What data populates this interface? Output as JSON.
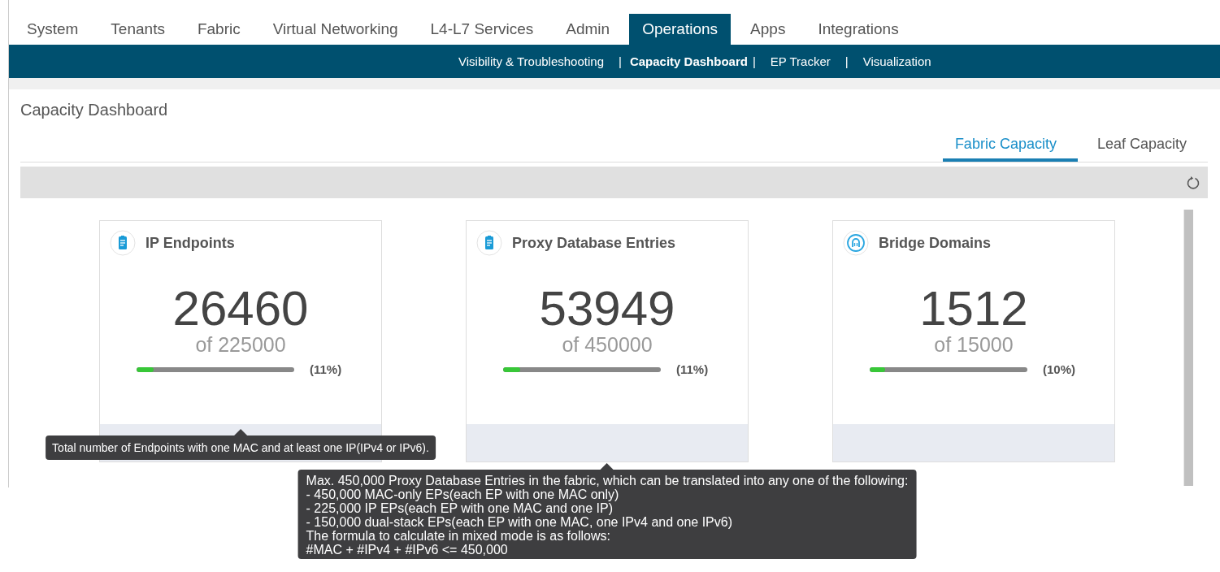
{
  "top_tabs": [
    {
      "label": "System",
      "selected": false
    },
    {
      "label": "Tenants",
      "selected": false
    },
    {
      "label": "Fabric",
      "selected": false
    },
    {
      "label": "Virtual Networking",
      "selected": false
    },
    {
      "label": "L4-L7 Services",
      "selected": false
    },
    {
      "label": "Admin",
      "selected": false
    },
    {
      "label": "Operations",
      "selected": true
    },
    {
      "label": "Apps",
      "selected": false
    },
    {
      "label": "Integrations",
      "selected": false
    }
  ],
  "sub_nav": [
    {
      "kind": "link",
      "label": "Visibility & Troubleshooting",
      "selected": false
    },
    {
      "kind": "separator",
      "label": "|"
    },
    {
      "kind": "link",
      "label": "Capacity Dashboard",
      "selected": true
    },
    {
      "kind": "separator",
      "label": "|"
    },
    {
      "kind": "link",
      "label": "EP Tracker",
      "selected": false
    },
    {
      "kind": "separator",
      "label": "|"
    },
    {
      "kind": "link",
      "label": "Visualization",
      "selected": false
    }
  ],
  "page_title": "Capacity Dashboard",
  "view_tabs": [
    {
      "label": "Fabric Capacity",
      "selected": true
    },
    {
      "label": "Leaf Capacity",
      "selected": false
    }
  ],
  "cards": [
    {
      "kind": "list",
      "title": "IP Endpoints",
      "value": "26460",
      "total": "of 225000",
      "level": 0.11,
      "percent": "(11%)",
      "tooltip": {
        "lines": [
          "Total number of Endpoints with one MAC and at least one IP(IPv4 or IPv6)."
        ]
      }
    },
    {
      "kind": "list",
      "title": "Proxy Database Entries",
      "value": "53949",
      "total": "of 450000",
      "level": 0.11,
      "percent": "(11%)",
      "tooltip": {
        "lines": [
          "Max. 450,000 Proxy Database Entries in the fabric, which can be translated into any one of the following:",
          "- 450,000 MAC-only EPs(each EP with one MAC only)",
          "- 225,000 IP EPs(each EP with one MAC and one IP)",
          "- 150,000 dual-stack EPs(each EP with one MAC, one IPv4 and one IPv6)",
          "The formula to calculate in mixed mode is as follows:",
          "#MAC + #IPv4 + #IPv6 <= 450,000"
        ]
      }
    },
    {
      "kind": "network",
      "title": "Bridge Domains",
      "value": "1512",
      "total": "of 15000",
      "level": 0.1,
      "percent": "(10%)"
    }
  ]
}
